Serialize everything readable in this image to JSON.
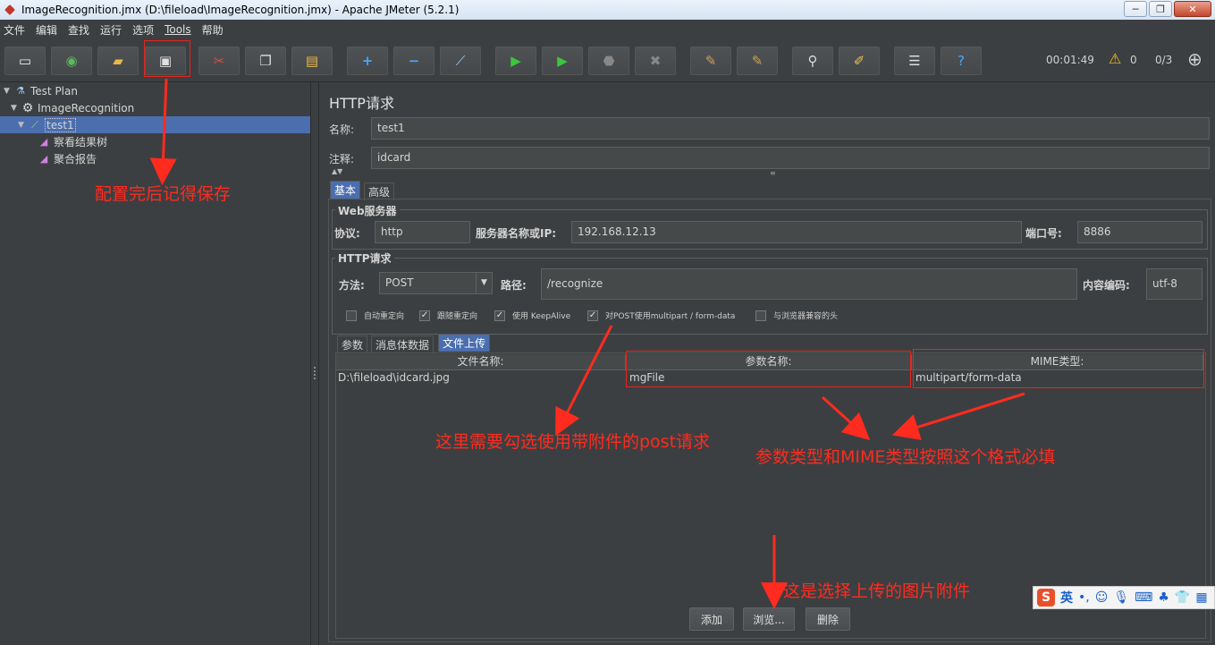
{
  "window": {
    "title": "ImageRecognition.jmx (D:\\fileload\\ImageRecognition.jmx) - Apache JMeter (5.2.1)"
  },
  "menu": [
    "文件",
    "编辑",
    "查找",
    "运行",
    "选项",
    "Tools",
    "帮助"
  ],
  "toolbar": {
    "timer": "00:01:49",
    "warnings": "0",
    "threads": "0/3"
  },
  "tree": {
    "items": [
      {
        "label": "Test Plan"
      },
      {
        "label": "ImageRecognition"
      },
      {
        "label": "test1"
      },
      {
        "label": "察看结果树"
      },
      {
        "label": "聚合报告"
      }
    ]
  },
  "panel": {
    "title": "HTTP请求",
    "name_label": "名称:",
    "name_value": "test1",
    "comment_label": "注释:",
    "comment_value": "idcard",
    "tabs": [
      "基本",
      "高级"
    ],
    "web_server": {
      "title": "Web服务器",
      "protocol_label": "协议:",
      "protocol_value": "http",
      "server_label": "服务器名称或IP:",
      "server_value": "192.168.12.13",
      "port_label": "端口号:",
      "port_value": "8886"
    },
    "http_request": {
      "title": "HTTP请求",
      "method_label": "方法:",
      "method_value": "POST",
      "path_label": "路径:",
      "path_value": "/recognize",
      "encoding_label": "内容编码:",
      "encoding_value": "utf-8"
    },
    "checkboxes": [
      {
        "label": "自动重定向",
        "checked": false
      },
      {
        "label": "跟随重定向",
        "checked": true
      },
      {
        "label": "使用 KeepAlive",
        "checked": true
      },
      {
        "label": "对POST使用multipart / form-data",
        "checked": true
      },
      {
        "label": "与浏览器兼容的头",
        "checked": false
      }
    ],
    "subtabs": [
      "参数",
      "消息体数据",
      "文件上传"
    ],
    "files_table": {
      "headers": [
        "文件名称:",
        "参数名称:",
        "MIME类型:"
      ],
      "rows": [
        [
          "D:\\fileload\\idcard.jpg",
          "mgFile",
          "multipart/form-data"
        ]
      ]
    },
    "buttons": {
      "add": "添加",
      "browse": "浏览...",
      "delete": "删除"
    }
  },
  "annotations": {
    "save_note": "配置完后记得保存",
    "multipart_note": "这里需要勾选使用带附件的post请求",
    "mime_note": "参数类型和MIME类型按照这个格式必填",
    "browse_note": "这是选择上传的图片附件"
  },
  "ime": {
    "lang": "英"
  },
  "colors": {
    "annotation": "#ff2b1f",
    "selection": "#4b6eaf",
    "background": "#3c3f41"
  }
}
